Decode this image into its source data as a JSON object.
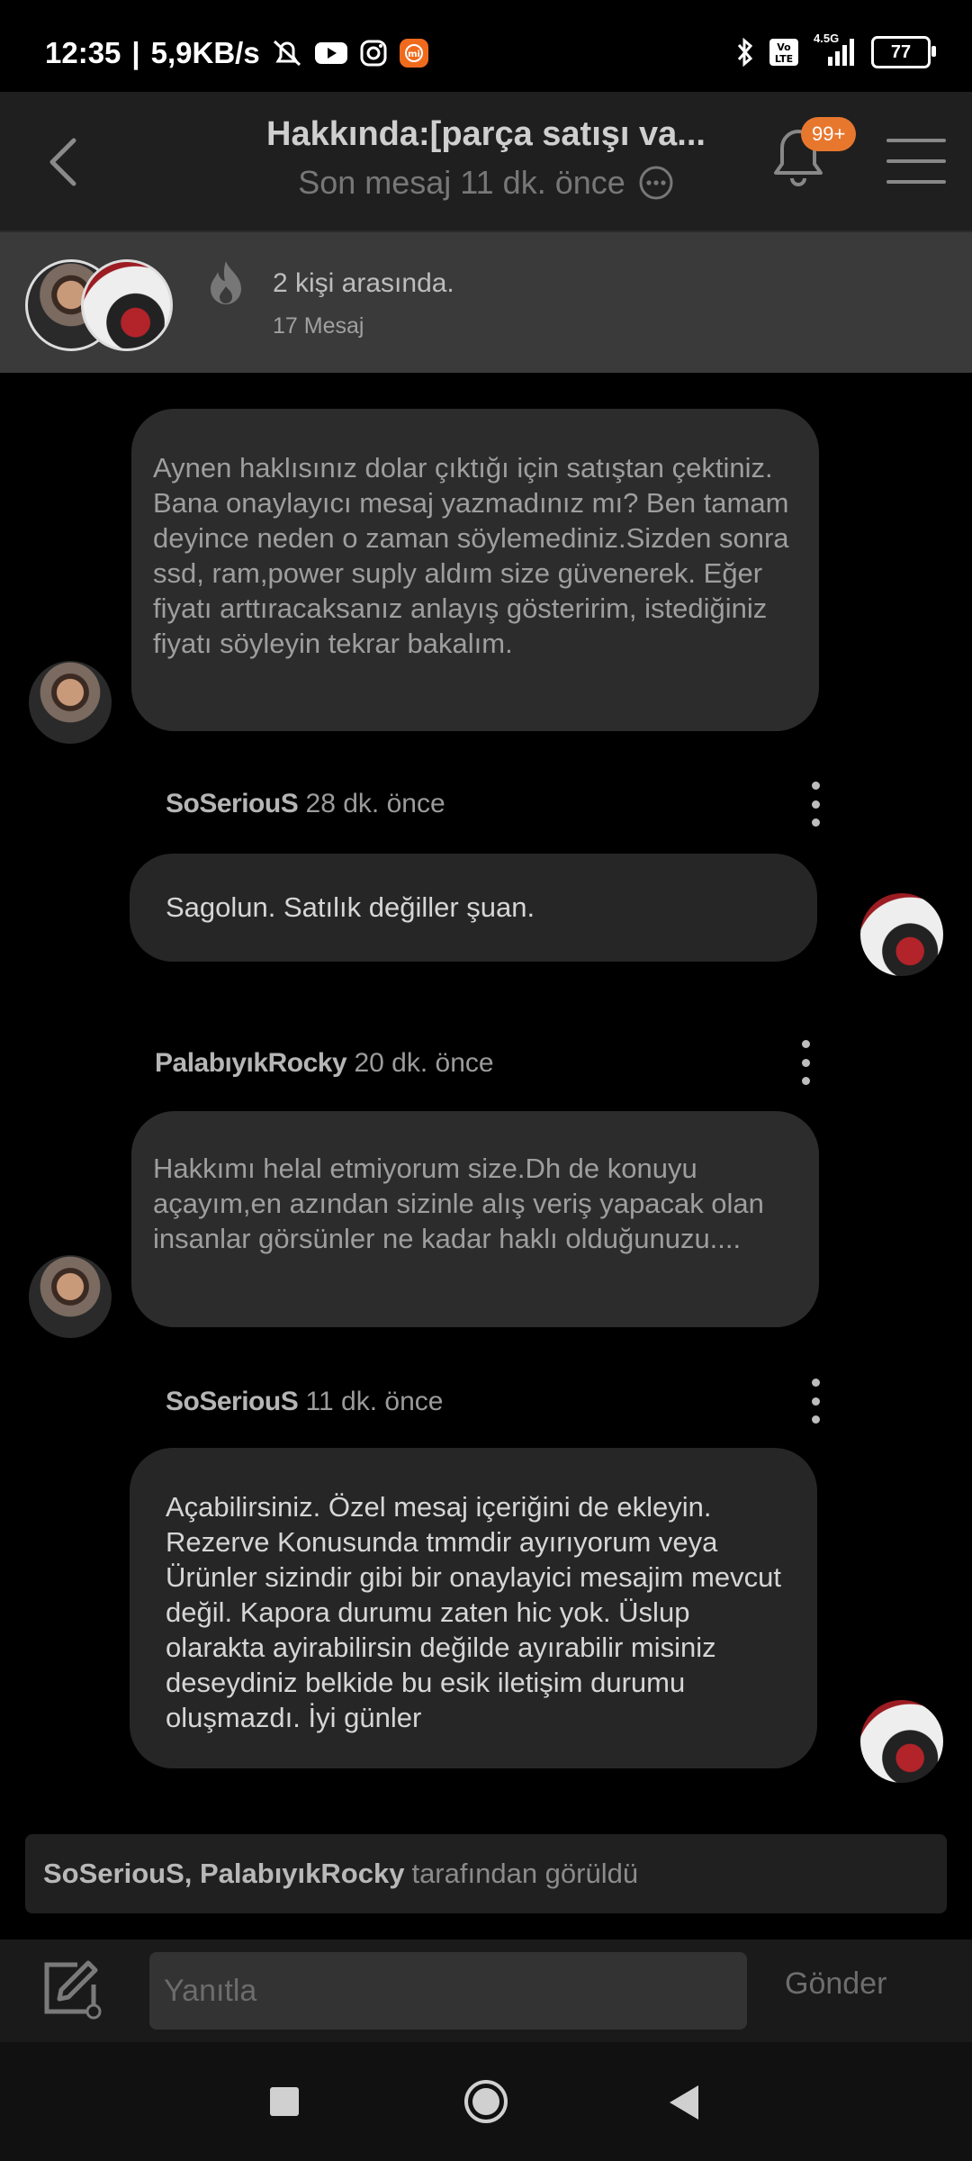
{
  "status_bar": {
    "time": "12:35",
    "speed": "5,9KB/s",
    "battery": "77",
    "network": "4.5G",
    "icons": [
      "alarm-off-icon",
      "youtube-icon",
      "instagram-icon",
      "mi-app-icon",
      "bluetooth-icon",
      "volte-icon",
      "signal-icon",
      "battery-icon"
    ]
  },
  "header": {
    "title": "Hakkında:[parça satışı va...",
    "subtitle": "Son mesaj 11 dk. önce",
    "badge": "99+"
  },
  "participants": {
    "count_text": "2 kişi arasında.",
    "messages_text": "17 Mesaj"
  },
  "messages": [
    {
      "author": "",
      "time": "",
      "text": "Aynen haklısınız dolar çıktığı için satıştan çektiniz. Bana onaylayıcı mesaj yazmadınız mı? Ben tamam deyince neden o zaman söylemediniz.Sizden sonra ssd, ram,power suply aldım size güvenerek. Eğer fiyatı arttıracaksanız anlayış gösteririm, istediğiniz fiyatı söyleyin tekrar bakalım."
    },
    {
      "author": "SoSeriouS",
      "time": "28 dk. önce",
      "text": "Sagolun. Satılık değiller şuan."
    },
    {
      "author": "PalabıyıkRocky",
      "time": "20 dk. önce",
      "text": "Hakkımı helal etmiyorum size.Dh de konuyu açayım,en azından sizinle alış veriş yapacak olan insanlar görsünler ne kadar haklı olduğunuzu...."
    },
    {
      "author": "SoSeriouS",
      "time": "11 dk. önce",
      "text": "Açabilirsiniz. Özel mesaj içeriğini de ekleyin. Rezerve Konusunda tmmdir ayırıyorum veya Ürünler sizindir gibi bir onaylayici mesajim mevcut değil. Kapora durumu zaten hic yok. Üslup olarakta ayirabilirsin değilde ayırabilir misiniz deseydiniz belkide bu esik iletişim durumu oluşmazdı. İyi günler"
    }
  ],
  "seen": {
    "names": "SoSeriouS, PalabıyıkRocky",
    "suffix": "tarafından görüldü"
  },
  "composer": {
    "placeholder": "Yanıtla",
    "send_label": "Gönder"
  },
  "colors": {
    "accent": "#e8772e",
    "background": "#000000",
    "bubble": "#2c2c2c"
  }
}
